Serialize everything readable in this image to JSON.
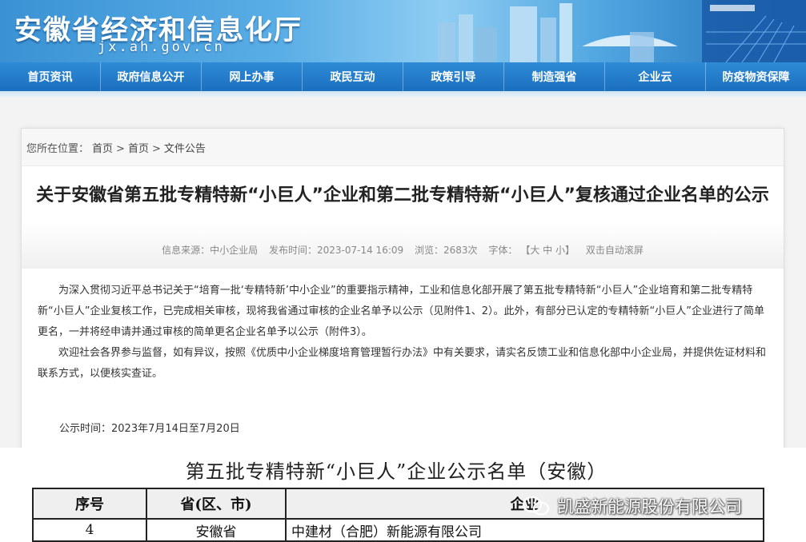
{
  "header": {
    "site_title": "安徽省经济和信息化厅",
    "site_domain": "jx.ah.gov.cn"
  },
  "nav": {
    "items": [
      "首页资讯",
      "政府信息公开",
      "网上办事",
      "政民互动",
      "政策引导",
      "制造强省",
      "企业云",
      "防疫物资保障"
    ]
  },
  "breadcrumb": {
    "prefix": "您所在位置：",
    "items": [
      "首页",
      "首页",
      "文件公告"
    ],
    "separator": ">"
  },
  "article": {
    "title": "关于安徽省第五批专精特新“小巨人”企业和第二批专精特新“小巨人”复核通过企业名单的公示",
    "meta": {
      "source": "信息来源：中小企业局",
      "published": "发布时间：2023-07-14 16:09",
      "views": "浏览：2683次",
      "font_label": "字体：",
      "font_sizes": "【大 中 小】",
      "auto_scroll": "双击自动滚屏"
    },
    "paragraphs": [
      "为深入贯彻习近平总书记关于“培育一批‘专精特新’中小企业”的重要指示精神，工业和信息化部开展了第五批专精特新“小巨人”企业培育和第二批专精特新“小巨人”企业复核工作，已完成相关审核，现将我省通过审核的企业名单予以公示（见附件1、2）。此外，有部分已认定的专精特新“小巨人”企业进行了简单更名，一并将经申请并通过审核的简单更名企业名单予以公示（附件3）。",
      "欢迎社会各界参与监督，如有异议，按照《优质中小企业梯度培育管理暂行办法》中有关要求，请实名反馈工业和信息化部中小企业局，并提供佐证材料和联系方式，以便核实查证。"
    ],
    "pub_time": "公示时间：2023年7月14日至7月20日"
  },
  "scan": {
    "table_title": "第五批专精特新“小巨人”企业公示名单（安徽）",
    "headers": [
      "序号",
      "省(区、市)",
      "企业"
    ],
    "rows": [
      [
        "4",
        "安徽省",
        "中建材（合肥）新能源有限公司"
      ]
    ]
  },
  "watermark": {
    "text": "凯盛新能源股份有限公司",
    "icon": "wechat-icon"
  },
  "colors": {
    "nav_bg": "#1f78c8",
    "banner": "#3a92d4"
  }
}
